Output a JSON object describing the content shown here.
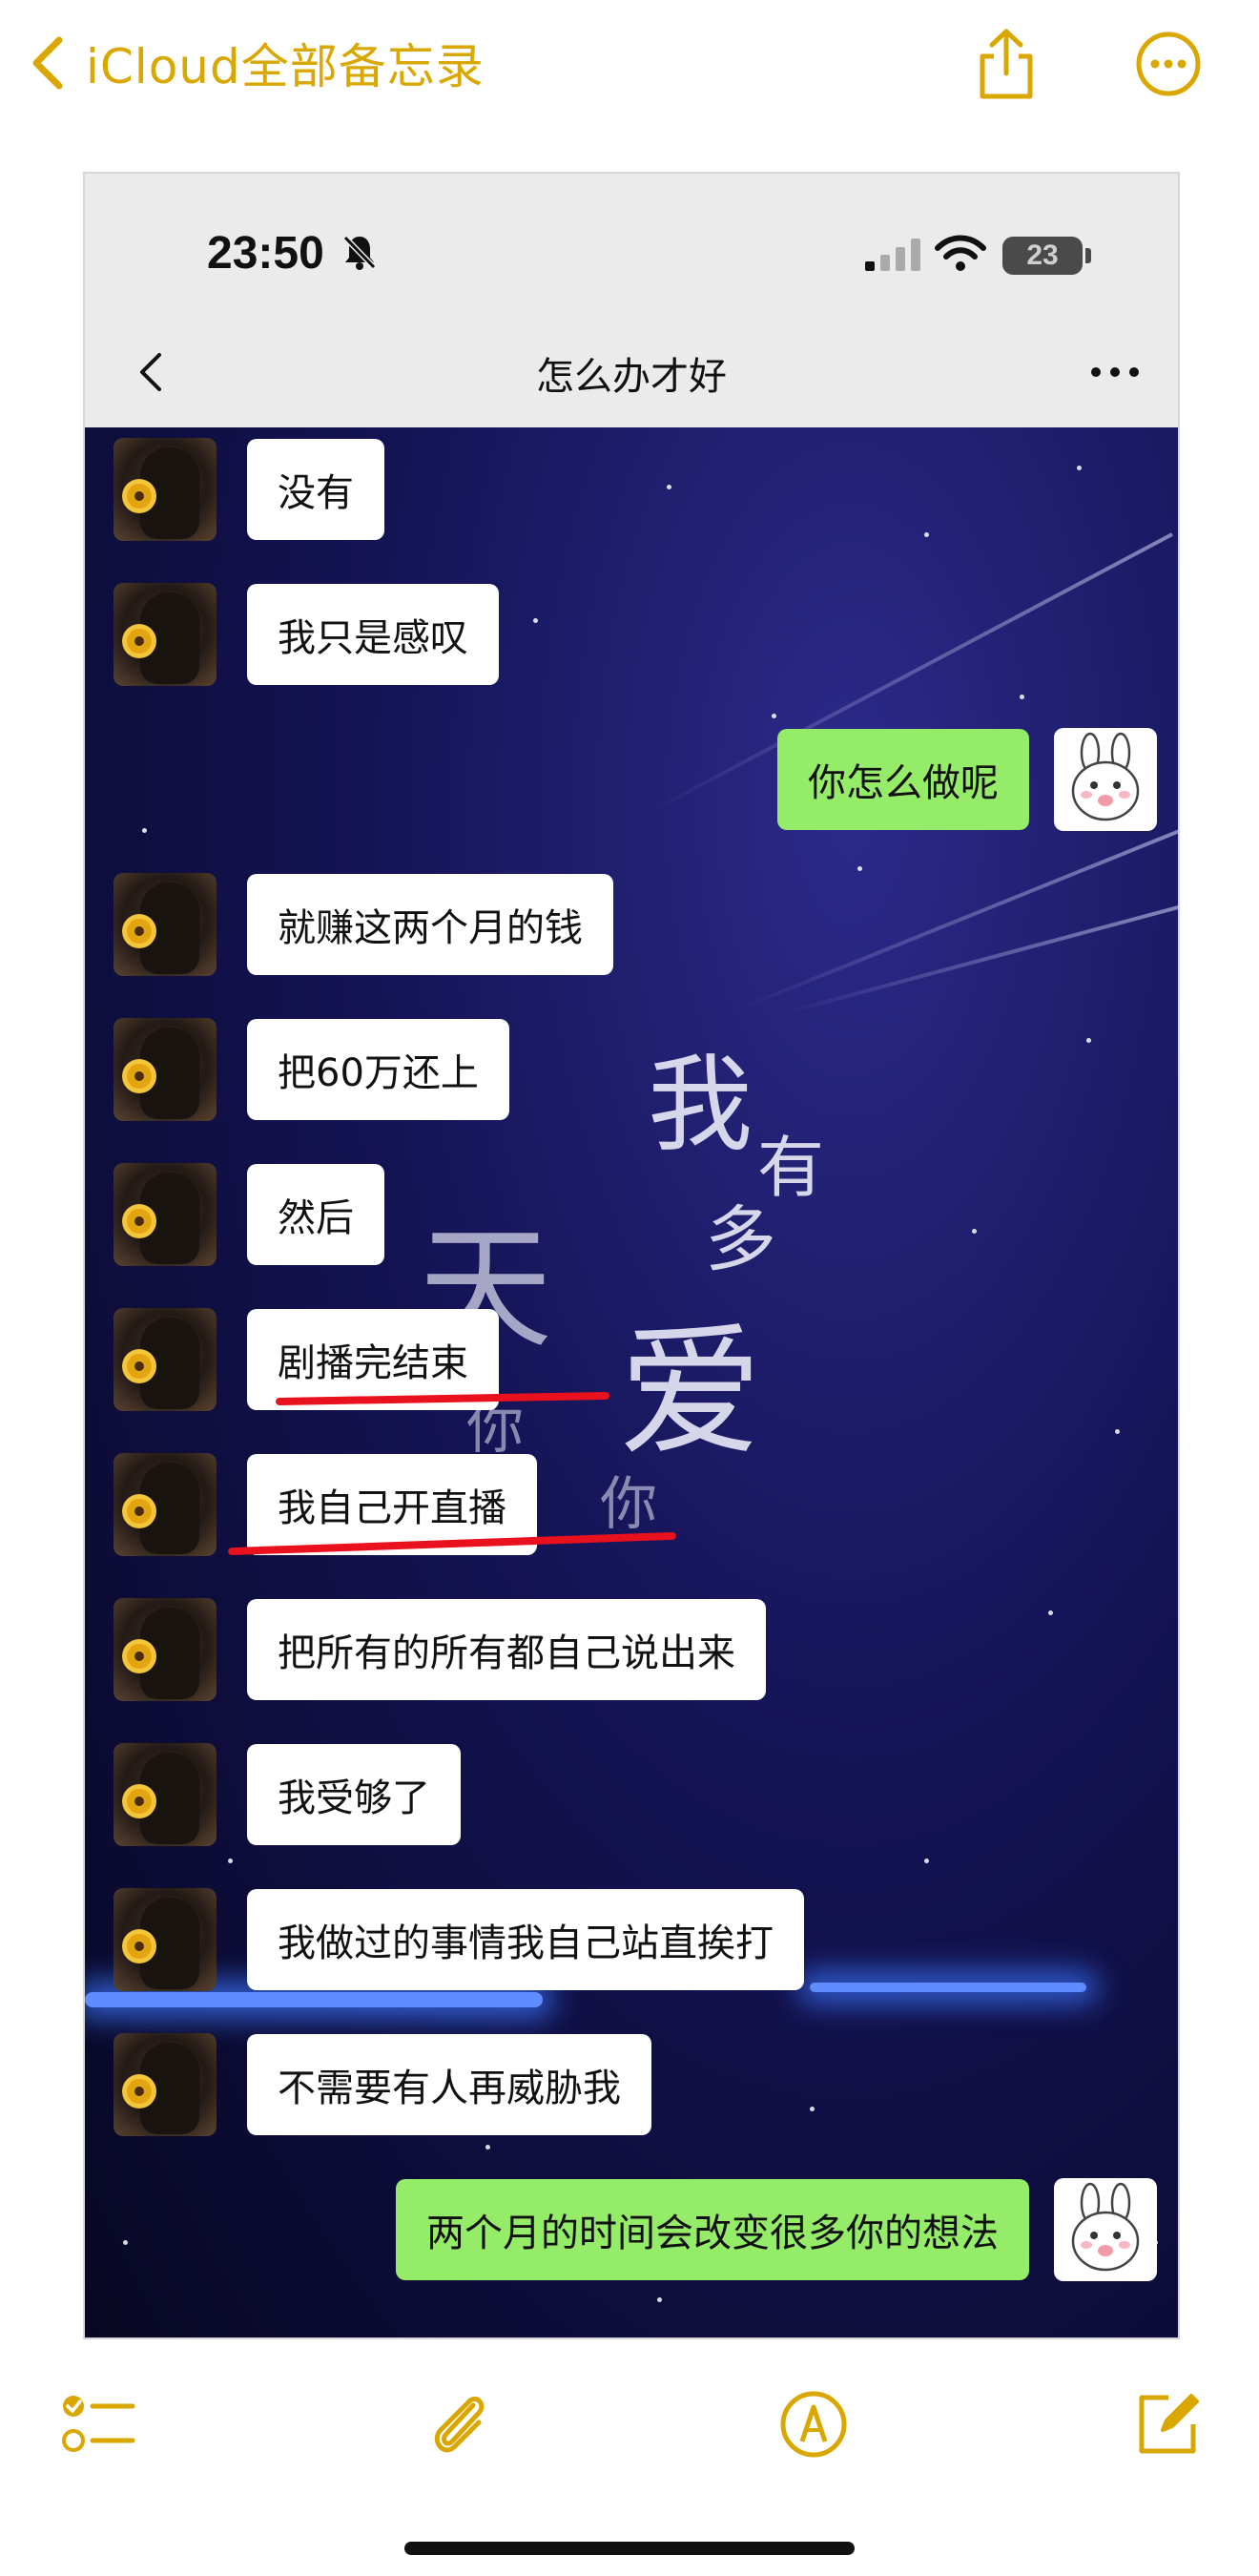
{
  "notes": {
    "back_label": "iCloud全部备忘录",
    "accent_color": "#d9a700",
    "icons": {
      "back": "chevron-left-icon",
      "share": "share-icon",
      "more": "ellipsis-circle-icon"
    }
  },
  "screenshot": {
    "status_bar": {
      "time": "23:50",
      "battery": "23",
      "icons": [
        "bell-slash-icon",
        "cellular-signal-icon",
        "wifi-icon",
        "battery-icon"
      ]
    },
    "chat": {
      "title": "怎么办才好",
      "icons": {
        "back": "chevron-left-icon",
        "more": "more-dots-icon"
      },
      "background_lyrics": [
        "我",
        "有",
        "多",
        "爱",
        "天",
        "你",
        "你"
      ],
      "messages": [
        {
          "side": "left",
          "text": "没有"
        },
        {
          "side": "left",
          "text": "我只是感叹"
        },
        {
          "side": "right",
          "text": "你怎么做呢"
        },
        {
          "side": "left",
          "text": "就赚这两个月的钱"
        },
        {
          "side": "left",
          "text": "把60万还上"
        },
        {
          "side": "left",
          "text": "然后"
        },
        {
          "side": "left",
          "text": "剧播完结束",
          "underlined": true
        },
        {
          "side": "left",
          "text": "我自己开直播",
          "underlined": true
        },
        {
          "side": "left",
          "text": "把所有的所有都自己说出来"
        },
        {
          "side": "left",
          "text": "我受够了"
        },
        {
          "side": "left",
          "text": "我做过的事情我自己站直挨打"
        },
        {
          "side": "left",
          "text": "不需要有人再威胁我"
        },
        {
          "side": "right",
          "text": "两个月的时间会改变很多你的想法"
        }
      ],
      "colors": {
        "bubble_left": "#ffffff",
        "bubble_right": "#95ec69",
        "underline": "#e8111d"
      }
    }
  },
  "toolbar": {
    "icons": [
      "checklist-icon",
      "paperclip-icon",
      "markup-pen-icon",
      "compose-icon"
    ]
  }
}
